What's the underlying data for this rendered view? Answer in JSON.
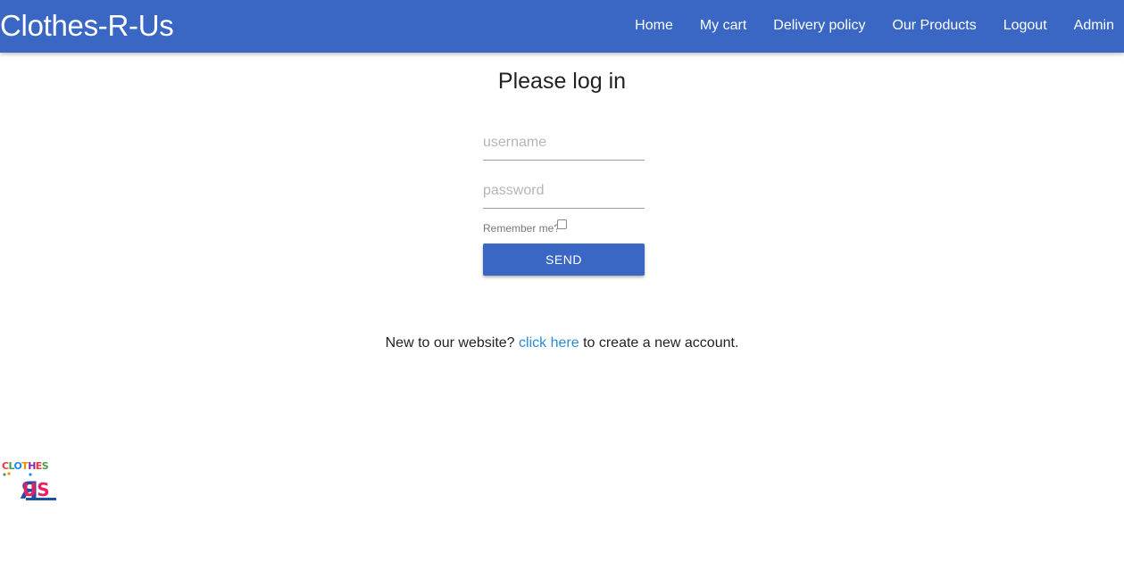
{
  "navbar": {
    "brand": "Clothes-R-Us",
    "links": [
      "Home",
      "My cart",
      "Delivery policy",
      "Our Products",
      "Logout",
      "Admin"
    ]
  },
  "login": {
    "title": "Please log in",
    "username_placeholder": "username",
    "password_placeholder": "password",
    "remember_label": "Remember me?",
    "remember_checked": false,
    "send_label": "SEND"
  },
  "register": {
    "prefix": "New to our website?",
    "link_text": "click here",
    "suffix": "to create a new account."
  },
  "footer": {
    "logo_line1": "CLOTHES",
    "logo_line2": "RUS"
  },
  "colors": {
    "primary": "#3a67c4",
    "link": "#2a8ad8"
  }
}
